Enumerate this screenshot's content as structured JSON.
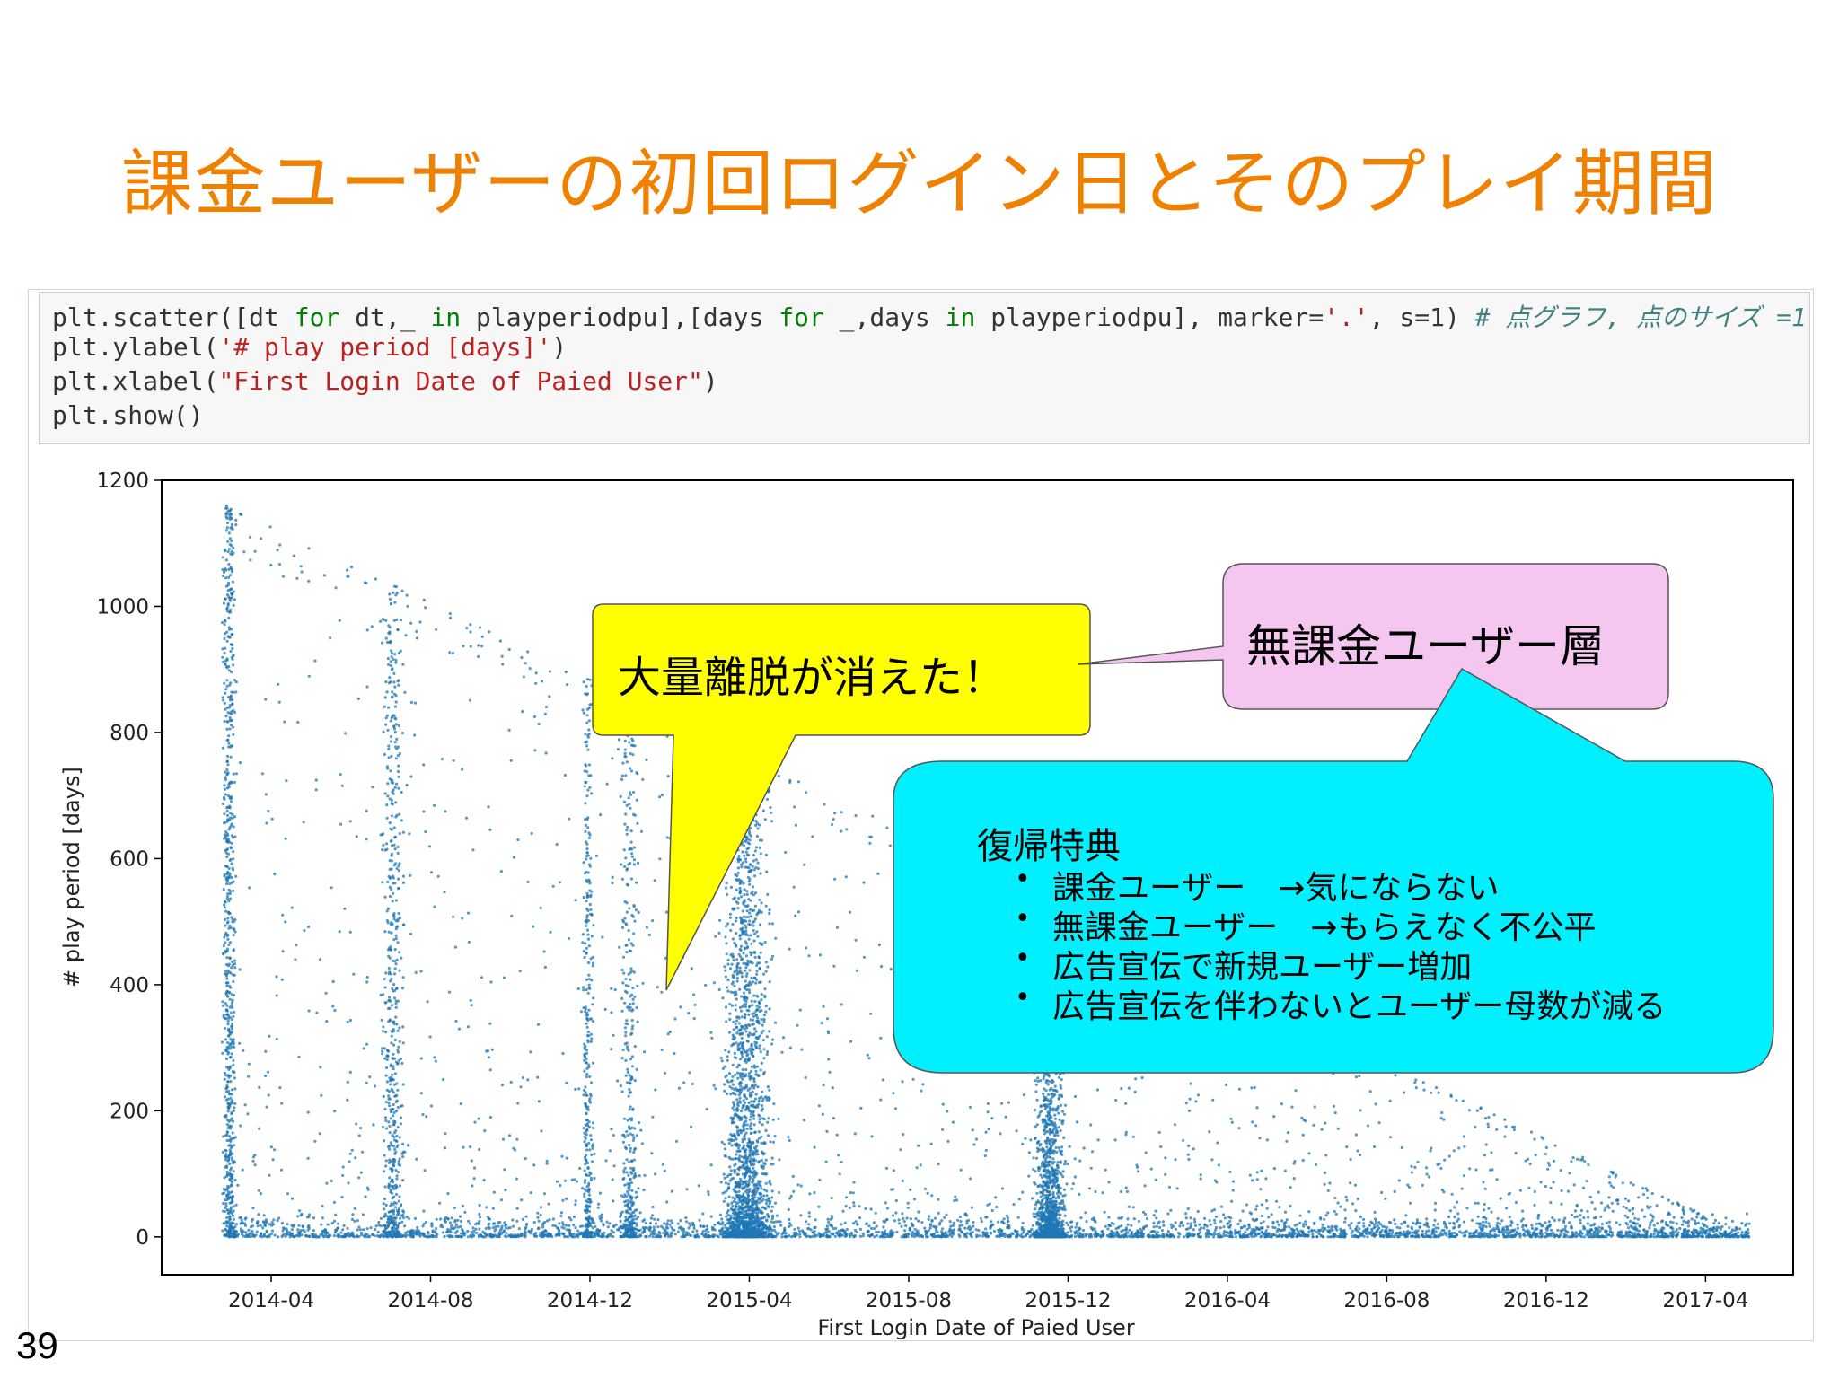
{
  "slide": {
    "title": "課金ユーザーの初回ログイン日とそのプレイ期間",
    "page_number": "39"
  },
  "code_cell": {
    "line1": {
      "p1": "plt.scatter([dt ",
      "kw1": "for",
      "p2": " dt,_ ",
      "kw2": "in",
      "p3": " playperiodpu],[days ",
      "kw3": "for",
      "p4": " _,days ",
      "kw4": "in",
      "p5": " playperiodpu], marker=",
      "s1": "'.'",
      "p6": ", s=1) ",
      "comment": "# 点グラフ, 点のサイズ =1"
    },
    "line2": {
      "p1": "plt.ylabel(",
      "s1": "'# play period [days]'",
      "p2": ")"
    },
    "line3": {
      "p1": "plt.xlabel(",
      "s1": "\"First Login Date of Paied User\"",
      "p2": ")"
    },
    "line4": {
      "p1": "plt.show()"
    }
  },
  "callouts": {
    "yellow": {
      "text": "大量離脱が消えた！",
      "color": "#ffff00"
    },
    "pink": {
      "text": "無課金ユーザー層",
      "color": "#f5c6f0"
    },
    "cyan": {
      "color": "#00f0ff",
      "heading": "復帰特典",
      "bullets": [
        "課金ユーザー　→気にならない",
        "無課金ユーザー　→もらえなく不公平",
        "広告宣伝で新規ユーザー増加",
        "広告宣伝を伴わないとユーザー母数が減る"
      ]
    }
  },
  "chart_data": {
    "type": "scatter",
    "xlabel": "First Login Date of Paied User",
    "ylabel": "# play period [days]",
    "x_tick_labels": [
      "2014-04",
      "2014-08",
      "2014-12",
      "2015-04",
      "2015-08",
      "2015-12",
      "2016-04",
      "2016-08",
      "2016-12",
      "2017-04"
    ],
    "y_tick_labels": [
      "0",
      "200",
      "400",
      "600",
      "800",
      "1000",
      "1200"
    ],
    "y_ticks": [
      0,
      200,
      400,
      600,
      800,
      1000,
      1200
    ],
    "xlim": [
      "2014-01",
      "2017-06"
    ],
    "ylim": [
      -60,
      1200
    ],
    "marker_color": "#1f77b4",
    "grid": false,
    "points_note_clusters": [
      {
        "x": "2014-03",
        "ymax": 1140
      },
      {
        "x": "2014-07",
        "ymax": 1020
      },
      {
        "x": "2014-12",
        "ymax": 880
      },
      {
        "x": "2015-01",
        "ymax": 860
      },
      {
        "x": "2015-04",
        "ymax": 780
      },
      {
        "x": "2015-11",
        "ymax": 500
      },
      {
        "x": "2017-05",
        "ymax": 0
      }
    ]
  }
}
